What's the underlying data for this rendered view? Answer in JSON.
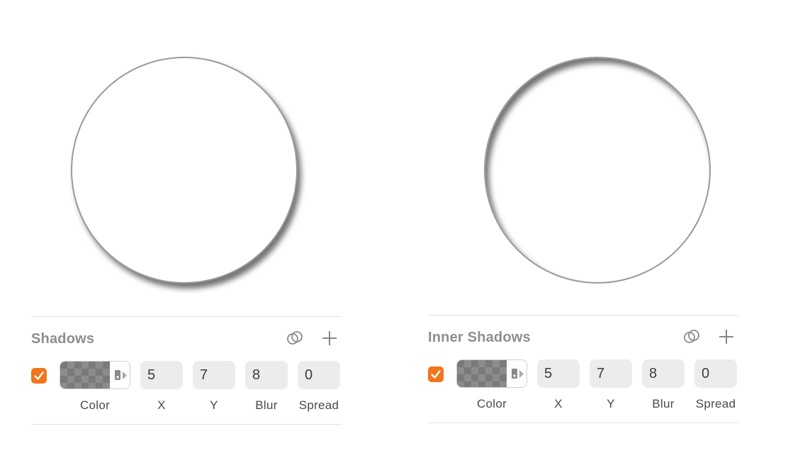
{
  "left_panel": {
    "title": "Shadows",
    "enabled": true,
    "color_value": "#000000 (transparent checker preview)",
    "fields": {
      "x": "5",
      "y": "7",
      "blur": "8",
      "spread": "0"
    },
    "labels": {
      "color": "Color",
      "x": "X",
      "y": "Y",
      "blur": "Blur",
      "spread": "Spread"
    }
  },
  "right_panel": {
    "title": "Inner Shadows",
    "enabled": true,
    "fields": {
      "x": "5",
      "y": "7",
      "blur": "8",
      "spread": "0"
    },
    "labels": {
      "color": "Color",
      "x": "X",
      "y": "Y",
      "blur": "Blur",
      "spread": "Spread"
    }
  },
  "icons": {
    "link": "link-rings-icon",
    "add": "plus-icon",
    "check": "checkmark-icon",
    "color_picker_tab": "color-picker-icon"
  },
  "colors": {
    "accent": "#f0751c",
    "title_gray": "#8e8e8e",
    "field_bg": "#ececec",
    "circle_border": "#9a9a9a"
  }
}
